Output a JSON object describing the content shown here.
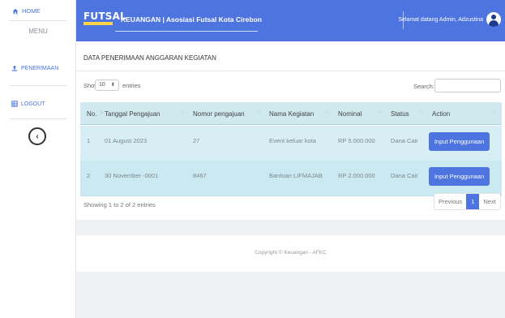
{
  "sidebar": {
    "home_label": "HOME",
    "menu_heading": "MENU",
    "items": [
      {
        "label": "PENERIMAAN",
        "icon": "upload-icon"
      },
      {
        "label": "LOGOUT",
        "icon": "table-icon"
      }
    ],
    "toggle_icon": "chevron-left-icon"
  },
  "topbar": {
    "logo_text": "FUTSAL",
    "title": "KEUANGAN | Asosiasi Futsal Kota Cirebon",
    "welcome": "Selamat datang Admin, Adzustina"
  },
  "card": {
    "title": "DATA PENERIMAAN ANGGARAN KEGIATAN",
    "show_label": "Show",
    "entries_value": "10",
    "entries_label": "entries",
    "search_label": "Search:",
    "search_value": ""
  },
  "table": {
    "columns": [
      "No.",
      "Tanggal Pengajuan",
      "Nomor pengajuan",
      "Nama Kegiatan",
      "Nominal",
      "Status",
      "Action"
    ],
    "rows": [
      {
        "no": "1",
        "tanggal": "01 August 2023",
        "nomor": "27",
        "nama": "Event keluar kota",
        "nominal": "RP 5.000.000",
        "status": "Dana Cair",
        "action": "Input Penggunaan"
      },
      {
        "no": "2",
        "tanggal": "30 November -0001",
        "nomor": "8467",
        "nama": "Bantuan LIFMAJAB",
        "nominal": "RP 2.000.000",
        "status": "Dana Cair",
        "action": "Input Penggunaan"
      }
    ]
  },
  "pagination": {
    "info": "Showing 1 to 2 of 2 entries",
    "previous": "Previous",
    "current": "1",
    "next": "Next"
  },
  "footer": {
    "copyright": "Copyright © Keuangan - AFKC"
  },
  "colors": {
    "primary": "#4d74df",
    "table_header": "#cfe9ef",
    "row_bg": "#d6eef4"
  }
}
